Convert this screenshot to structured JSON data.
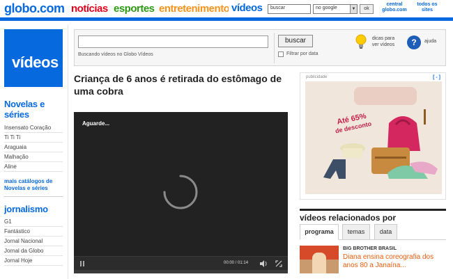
{
  "header": {
    "logo": "globo.com",
    "nav": [
      "notícias",
      "esportes",
      "entretenimento",
      "vídeos"
    ],
    "search_value": "buscar",
    "search_scope": "no google",
    "ok_label": "ok",
    "central_label": "central globo.com",
    "todos_label": "todos os sites"
  },
  "sidebar": {
    "tile_label": "vídeos",
    "novelas_title": "Novelas e séries",
    "novelas_items": [
      "Insensato Coração",
      "Ti Ti Ti",
      "Araguaia",
      "Malhação",
      "Aline"
    ],
    "novelas_more": "mais catálogos de Novelas e séries",
    "jornalismo_title": "jornalismo",
    "jornalismo_items": [
      "G1",
      "Fantástico",
      "Jornal Nacional",
      "Jornal da Globo",
      "Jornal Hoje"
    ]
  },
  "search": {
    "caption": "Buscando vídeos no Globo Vídeos",
    "button_label": "buscar",
    "filter_label": "Filtrar por data",
    "tips_label": "dicas para ver vídeos",
    "help_label": "ajuda"
  },
  "video": {
    "title": "Criança de 6 anos é retirada do estômago de uma cobra",
    "status": "Aguarde...",
    "time": "00:00 / 01:14",
    "progress": 0
  },
  "ad": {
    "label": "publicidade",
    "close": "[ - ]",
    "promo_line1": "Até 65%",
    "promo_line2": "de desconto"
  },
  "related": {
    "title": "vídeos relacionados por",
    "tabs": [
      "programa",
      "temas",
      "data"
    ],
    "item": {
      "kicker": "BIG BROTHER BRASIL",
      "title": "Diana ensina coreografia dos anos 80 a Janaína..."
    }
  },
  "colors": {
    "brand_blue": "#0669de",
    "noticias": "#e2001a",
    "esportes": "#2d9a14",
    "entretenimento": "#f7941d",
    "related_title": "#ee5c0c"
  }
}
